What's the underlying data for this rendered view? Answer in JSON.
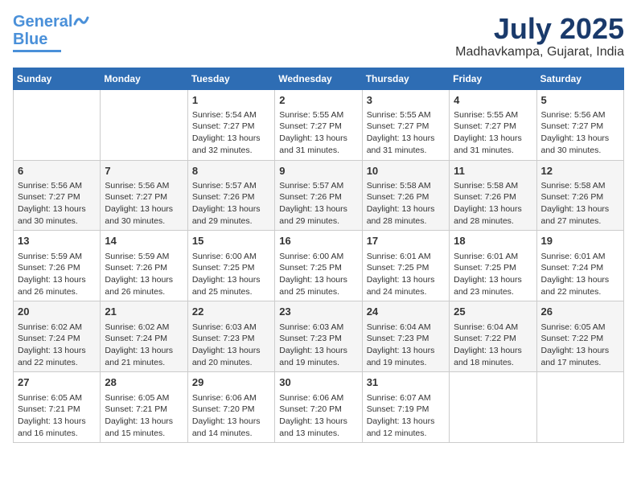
{
  "logo": {
    "line1": "General",
    "line2": "Blue"
  },
  "title": "July 2025",
  "location": "Madhavkampa, Gujarat, India",
  "weekdays": [
    "Sunday",
    "Monday",
    "Tuesday",
    "Wednesday",
    "Thursday",
    "Friday",
    "Saturday"
  ],
  "weeks": [
    [
      {
        "day": "",
        "info": ""
      },
      {
        "day": "",
        "info": ""
      },
      {
        "day": "1",
        "info": "Sunrise: 5:54 AM\nSunset: 7:27 PM\nDaylight: 13 hours\nand 32 minutes."
      },
      {
        "day": "2",
        "info": "Sunrise: 5:55 AM\nSunset: 7:27 PM\nDaylight: 13 hours\nand 31 minutes."
      },
      {
        "day": "3",
        "info": "Sunrise: 5:55 AM\nSunset: 7:27 PM\nDaylight: 13 hours\nand 31 minutes."
      },
      {
        "day": "4",
        "info": "Sunrise: 5:55 AM\nSunset: 7:27 PM\nDaylight: 13 hours\nand 31 minutes."
      },
      {
        "day": "5",
        "info": "Sunrise: 5:56 AM\nSunset: 7:27 PM\nDaylight: 13 hours\nand 30 minutes."
      }
    ],
    [
      {
        "day": "6",
        "info": "Sunrise: 5:56 AM\nSunset: 7:27 PM\nDaylight: 13 hours\nand 30 minutes."
      },
      {
        "day": "7",
        "info": "Sunrise: 5:56 AM\nSunset: 7:27 PM\nDaylight: 13 hours\nand 30 minutes."
      },
      {
        "day": "8",
        "info": "Sunrise: 5:57 AM\nSunset: 7:26 PM\nDaylight: 13 hours\nand 29 minutes."
      },
      {
        "day": "9",
        "info": "Sunrise: 5:57 AM\nSunset: 7:26 PM\nDaylight: 13 hours\nand 29 minutes."
      },
      {
        "day": "10",
        "info": "Sunrise: 5:58 AM\nSunset: 7:26 PM\nDaylight: 13 hours\nand 28 minutes."
      },
      {
        "day": "11",
        "info": "Sunrise: 5:58 AM\nSunset: 7:26 PM\nDaylight: 13 hours\nand 28 minutes."
      },
      {
        "day": "12",
        "info": "Sunrise: 5:58 AM\nSunset: 7:26 PM\nDaylight: 13 hours\nand 27 minutes."
      }
    ],
    [
      {
        "day": "13",
        "info": "Sunrise: 5:59 AM\nSunset: 7:26 PM\nDaylight: 13 hours\nand 26 minutes."
      },
      {
        "day": "14",
        "info": "Sunrise: 5:59 AM\nSunset: 7:26 PM\nDaylight: 13 hours\nand 26 minutes."
      },
      {
        "day": "15",
        "info": "Sunrise: 6:00 AM\nSunset: 7:25 PM\nDaylight: 13 hours\nand 25 minutes."
      },
      {
        "day": "16",
        "info": "Sunrise: 6:00 AM\nSunset: 7:25 PM\nDaylight: 13 hours\nand 25 minutes."
      },
      {
        "day": "17",
        "info": "Sunrise: 6:01 AM\nSunset: 7:25 PM\nDaylight: 13 hours\nand 24 minutes."
      },
      {
        "day": "18",
        "info": "Sunrise: 6:01 AM\nSunset: 7:25 PM\nDaylight: 13 hours\nand 23 minutes."
      },
      {
        "day": "19",
        "info": "Sunrise: 6:01 AM\nSunset: 7:24 PM\nDaylight: 13 hours\nand 22 minutes."
      }
    ],
    [
      {
        "day": "20",
        "info": "Sunrise: 6:02 AM\nSunset: 7:24 PM\nDaylight: 13 hours\nand 22 minutes."
      },
      {
        "day": "21",
        "info": "Sunrise: 6:02 AM\nSunset: 7:24 PM\nDaylight: 13 hours\nand 21 minutes."
      },
      {
        "day": "22",
        "info": "Sunrise: 6:03 AM\nSunset: 7:23 PM\nDaylight: 13 hours\nand 20 minutes."
      },
      {
        "day": "23",
        "info": "Sunrise: 6:03 AM\nSunset: 7:23 PM\nDaylight: 13 hours\nand 19 minutes."
      },
      {
        "day": "24",
        "info": "Sunrise: 6:04 AM\nSunset: 7:23 PM\nDaylight: 13 hours\nand 19 minutes."
      },
      {
        "day": "25",
        "info": "Sunrise: 6:04 AM\nSunset: 7:22 PM\nDaylight: 13 hours\nand 18 minutes."
      },
      {
        "day": "26",
        "info": "Sunrise: 6:05 AM\nSunset: 7:22 PM\nDaylight: 13 hours\nand 17 minutes."
      }
    ],
    [
      {
        "day": "27",
        "info": "Sunrise: 6:05 AM\nSunset: 7:21 PM\nDaylight: 13 hours\nand 16 minutes."
      },
      {
        "day": "28",
        "info": "Sunrise: 6:05 AM\nSunset: 7:21 PM\nDaylight: 13 hours\nand 15 minutes."
      },
      {
        "day": "29",
        "info": "Sunrise: 6:06 AM\nSunset: 7:20 PM\nDaylight: 13 hours\nand 14 minutes."
      },
      {
        "day": "30",
        "info": "Sunrise: 6:06 AM\nSunset: 7:20 PM\nDaylight: 13 hours\nand 13 minutes."
      },
      {
        "day": "31",
        "info": "Sunrise: 6:07 AM\nSunset: 7:19 PM\nDaylight: 13 hours\nand 12 minutes."
      },
      {
        "day": "",
        "info": ""
      },
      {
        "day": "",
        "info": ""
      }
    ]
  ]
}
